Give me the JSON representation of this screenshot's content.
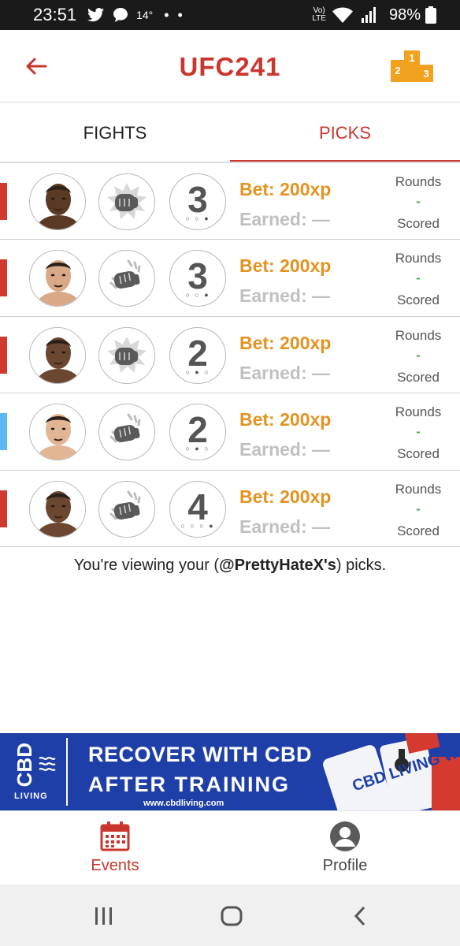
{
  "status_bar": {
    "time": "23:51",
    "temperature": "14°",
    "dots": "• •",
    "volte": "VoLTE",
    "battery": "98%"
  },
  "header": {
    "title": "UFC241",
    "back_icon": "back-arrow-icon",
    "leaderboard_icon": "podium-icon",
    "podium_places": [
      "1",
      "2",
      "3"
    ]
  },
  "tabs": [
    {
      "label": "FIGHTS",
      "active": false
    },
    {
      "label": "PICKS",
      "active": true
    }
  ],
  "picks": [
    {
      "side_color": "#d0392f",
      "method": "knockout",
      "round": "3",
      "round_dot_index": 2,
      "bet": "Bet: 200xp",
      "earned": "Earned: —",
      "rounds_label": "Rounds",
      "rounds_value": "-",
      "scored_label": "Scored",
      "skin": "#5a3a24"
    },
    {
      "side_color": "#d0392f",
      "method": "submission",
      "round": "3",
      "round_dot_index": 2,
      "bet": "Bet: 200xp",
      "earned": "Earned: —",
      "rounds_label": "Rounds",
      "rounds_value": "-",
      "scored_label": "Scored",
      "skin": "#d9a987"
    },
    {
      "side_color": "#d0392f",
      "method": "knockout",
      "round": "2",
      "round_dot_index": 1,
      "bet": "Bet: 200xp",
      "earned": "Earned: —",
      "rounds_label": "Rounds",
      "rounds_value": "-",
      "scored_label": "Scored",
      "skin": "#6b4630"
    },
    {
      "side_color": "#5bb8f2",
      "method": "submission",
      "round": "2",
      "round_dot_index": 1,
      "bet": "Bet: 200xp",
      "earned": "Earned: —",
      "rounds_label": "Rounds",
      "rounds_value": "-",
      "scored_label": "Scored",
      "skin": "#e2b594"
    },
    {
      "side_color": "#d0392f",
      "method": "submission",
      "round": "4",
      "round_dot_index": 3,
      "bet": "Bet: 200xp",
      "earned": "Earned: —",
      "rounds_label": "Rounds",
      "rounds_value": "-",
      "scored_label": "Scored",
      "skin": "#6b4630"
    }
  ],
  "viewing_note": {
    "prefix": "You're viewing your (",
    "handle": "@PrettyHateX's",
    "suffix": ") picks."
  },
  "ad": {
    "logo_top": "CBD",
    "logo_bottom": "LIVING",
    "line1": "RECOVER WITH CBD",
    "line2": "AFTER TRAINING",
    "url": "www.cbdliving.com",
    "product_text": "CBD LIVING WATER"
  },
  "bottom_nav": [
    {
      "label": "Events",
      "icon": "calendar-icon",
      "active": true
    },
    {
      "label": "Profile",
      "icon": "user-icon",
      "active": false
    }
  ],
  "colors": {
    "accent": "#c9362e",
    "bet": "#e5921e",
    "earned": "#c0c0c0",
    "rounds_value": "#4cae4c",
    "ad_background": "#1e3fa8"
  }
}
